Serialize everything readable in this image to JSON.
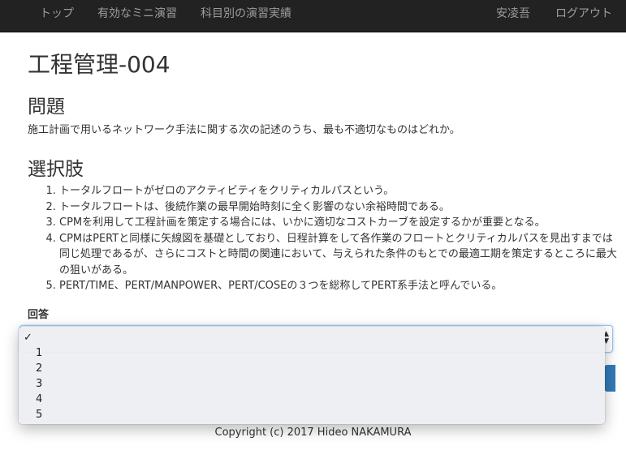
{
  "nav": {
    "left_items": [
      "トップ",
      "有効なミニ演習",
      "科目別の演習実績"
    ],
    "user_name": "安凌吾",
    "logout": "ログアウト"
  },
  "page_title": "工程管理-004",
  "question": {
    "heading": "問題",
    "text": "施工計画で用いるネットワーク手法に関する次の記述のうち、最も不適切なものはどれか。"
  },
  "choices": {
    "heading": "選択肢",
    "items": [
      "トータルフロートがゼロのアクティビティをクリティカルパスという。",
      "トータルフロートは、後続作業の最早開始時刻に全く影響のない余裕時間である。",
      "CPMを利用して工程計画を策定する場合には、いかに適切なコストカーブを設定するかが重要となる。",
      "CPMはPERTと同様に矢線図を基礎としており、日程計算をして各作業のフロートとクリティカルパスを見出すまでは同じ処理であるが、さらにコストと時間の関連において、与えられた条件のもとでの最適工期を策定するところに最大の狙いがある。",
      "PERT/TIME、PERT/MANPOWER、PERT/COSEの３つを総称してPERT系手法と呼んでいる。"
    ]
  },
  "answer": {
    "label": "回答",
    "selected": "",
    "options": [
      "",
      "1",
      "2",
      "3",
      "4",
      "5"
    ],
    "check_glyph": "✓"
  },
  "footer": "Copyright (c) 2017 Hideo NAKAMURA",
  "colors": {
    "navbar_bg": "#222222",
    "nav_text": "#9d9d9d",
    "primary_button": "#337ab7",
    "focus_border": "#9ec3f0"
  }
}
